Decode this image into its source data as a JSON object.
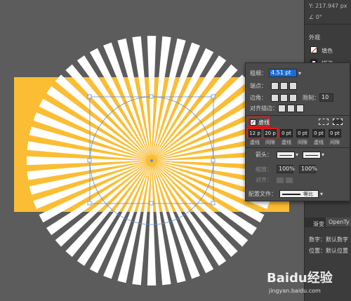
{
  "right_panel": {
    "top_value": "Y: 217.947 px",
    "angle_label": "0°",
    "section_appearance": "外观",
    "fill_label": "填色",
    "stroke_label": "描边",
    "tabs": [
      "渐变",
      "OpenTy"
    ],
    "number_label": "数字：",
    "number_value": "默认数字",
    "position_label": "位置：",
    "position_value": "默认位置"
  },
  "stroke_panel": {
    "weight_label": "粗细：",
    "weight_value": "4.51 pt",
    "cap_label": "端点：",
    "corner_label": "边角：",
    "limit_label": "限制：",
    "limit_value": "10",
    "align_label": "对齐描边：",
    "dashed_label": "虚线",
    "dash_values": [
      "12 p",
      "20 p",
      "0 pt",
      "0 pt",
      "0 pt",
      "0 pt"
    ],
    "dash_labels": [
      "虚线",
      "间隙",
      "虚线",
      "间隙",
      "虚线",
      "间隙"
    ],
    "arrow_label": "箭头：",
    "scale_label": "缩放：",
    "scale_values": [
      "100%",
      "100%"
    ],
    "align2_label": "对齐：",
    "profile_label": "配置文件：",
    "profile_value": "等比"
  },
  "watermark": {
    "brand": "Baidu经验",
    "url": "jingyan.baidu.com"
  },
  "colors": {
    "artboard": "#fbbd33",
    "rays": "#ffffff",
    "selection": "#5b8de0",
    "highlight": "#d61f1f"
  }
}
